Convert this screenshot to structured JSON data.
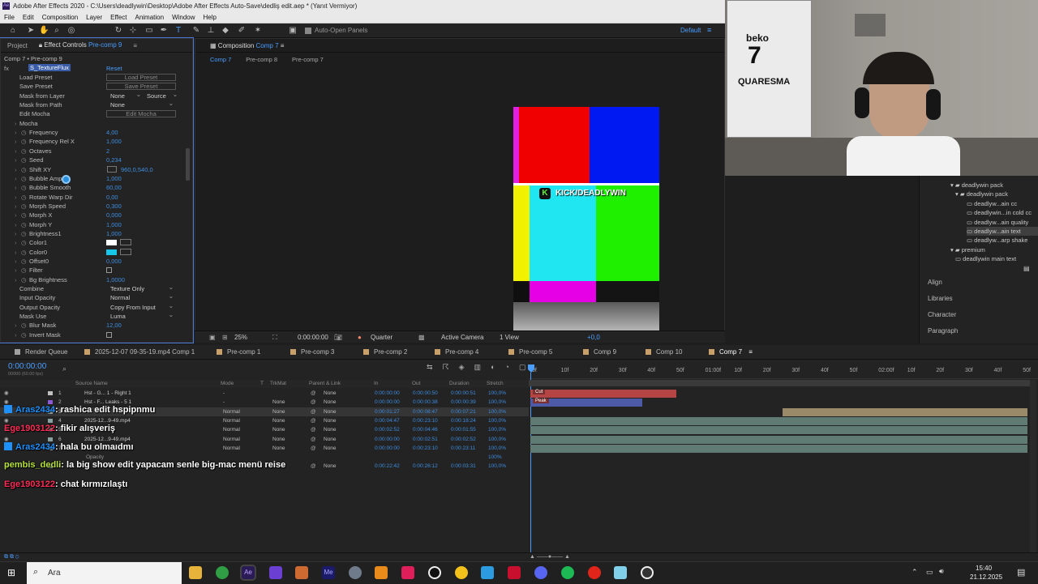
{
  "window": {
    "title": "Adobe After Effects 2020 - C:\\Users\\deadlywin\\Desktop\\Adobe After Effects Auto-Save\\dedliş edit.aep * (Yanıt Vermiyor)"
  },
  "menu": [
    "File",
    "Edit",
    "Composition",
    "Layer",
    "Effect",
    "Animation",
    "Window",
    "Help"
  ],
  "toolbar": {
    "auto_open": "Auto-Open Panels",
    "workspace": "Default"
  },
  "project_panel": {
    "tab_project": "Project",
    "tab_effects": "Effect Controls",
    "tab_effects_target": "Pre-comp 9",
    "breadcrumb": "Comp 7 • Pre-comp 9",
    "effect_name": "S_TextureFlux",
    "reset": "Reset",
    "params": [
      {
        "label": "Load Preset",
        "button": "Load Preset"
      },
      {
        "label": "Save Preset",
        "button": "Save Preset"
      },
      {
        "label": "Mask from Layer",
        "drop1": "None",
        "drop2": "Source"
      },
      {
        "label": "Mask from Path",
        "drop1": "None"
      },
      {
        "label": "Edit Mocha",
        "button": "Edit Mocha"
      },
      {
        "label": "Mocha"
      },
      {
        "label": "Frequency",
        "value": "4,00"
      },
      {
        "label": "Frequency Rel X",
        "value": "1,000"
      },
      {
        "label": "Octaves",
        "value": "2"
      },
      {
        "label": "Seed",
        "value": "0,234"
      },
      {
        "label": "Shift XY",
        "value": "960,0,540,0"
      },
      {
        "label": "Bubble Amp",
        "value": "1,000"
      },
      {
        "label": "Bubble Smooth",
        "value": "60,00"
      },
      {
        "label": "Rotate Warp Dir",
        "value": "0,00"
      },
      {
        "label": "Morph Speed",
        "value": "0,300"
      },
      {
        "label": "Morph X",
        "value": "0,000"
      },
      {
        "label": "Morph Y",
        "value": "1,000"
      },
      {
        "label": "Brightness1",
        "value": "1,000"
      },
      {
        "label": "Color1",
        "swatch": "#ffffff"
      },
      {
        "label": "Color0",
        "swatch": "#17c6e8"
      },
      {
        "label": "Offset0",
        "value": "0,000"
      },
      {
        "label": "Filter",
        "checkbox": true
      },
      {
        "label": "Bg Brightness",
        "value": "1,0000"
      },
      {
        "label": "Combine",
        "drop1": "Texture Only"
      },
      {
        "label": "Input Opacity",
        "drop1": "Normal"
      },
      {
        "label": "Output Opacity",
        "drop1": "Copy From Input"
      },
      {
        "label": "Mask Use",
        "drop1": "Luma"
      },
      {
        "label": "Blur Mask",
        "value": "12,00"
      },
      {
        "label": "Invert Mask",
        "checkbox": true
      }
    ]
  },
  "composition_panel": {
    "tab": "Composition",
    "tab_target": "Comp 7",
    "crumbs": [
      "Comp 7",
      "Pre-comp 8",
      "Pre-comp 7"
    ],
    "overlay_text": "KICK/DEADLYWIN",
    "viewer_bar": {
      "zoom": "25%",
      "time": "0:00:00:00",
      "resolution": "Quarter",
      "camera": "Active Camera",
      "view": "1 View",
      "exposure": "+0,0"
    }
  },
  "right_panel": {
    "tree": [
      "deadlywin pack",
      "deadlywin pack",
      "deadlyw...ain cc",
      "deadlywin...in cold cc",
      "deadlyw...ain quality",
      "deadlyw...ain text",
      "deadlyw...arp shake",
      "premium",
      "deadlywin main text"
    ],
    "sections": [
      "Align",
      "Libraries",
      "Character",
      "Paragraph"
    ]
  },
  "timeline": {
    "tabs": [
      "Render Queue",
      "2025-12-07 09-35-19.mp4 Comp 1",
      "Pre-comp 1",
      "Pre-comp 3",
      "Pre-comp 2",
      "Pre-comp 4",
      "Pre-comp 5",
      "Comp 9",
      "Comp 10",
      "Comp 7"
    ],
    "tab_colors": [
      "#a0a0a0",
      "#c9a06a",
      "#c9a06a",
      "#c9a06a",
      "#c9a06a",
      "#c9a06a",
      "#c9a06a",
      "#c9a06a",
      "#c9a06a",
      "#c9a06a"
    ],
    "timecode": "0:00:00:00",
    "fps": "00000 (60.00 fps)",
    "headers": [
      "Source Name",
      "Mode",
      "T",
      "TrkMat",
      "Parent & Link",
      "In",
      "Out",
      "Duration",
      "Stretch"
    ],
    "ruler": [
      "0f",
      "10f",
      "20f",
      "30f",
      "40f",
      "50f",
      "01:00f",
      "10f",
      "20f",
      "30f",
      "40f",
      "50f",
      "02:00f",
      "10f",
      "20f",
      "30f",
      "40f",
      "50f"
    ],
    "layers": [
      {
        "num": "1",
        "name": "Hst - G... 1 - Right 1",
        "mode": "-",
        "trk": "",
        "parent": "None",
        "in": "0:00:00:00",
        "out": "0:00:00:50",
        "dur": "0:00:00:51",
        "stretch": "100,0%"
      },
      {
        "num": "2",
        "name": "Hst - F... Leaks - 5 1",
        "mode": "-",
        "trk": "None",
        "parent": "None",
        "in": "0:00:00:00",
        "out": "0:00:00:38",
        "dur": "0:00:00:39",
        "stretch": "100,0%"
      },
      {
        "num": "3",
        "name": "",
        "mode": "Normal",
        "trk": "None",
        "parent": "None",
        "in": "0:00:01:27",
        "out": "0:00:08:47",
        "dur": "0:00:07:21",
        "stretch": "100,0%"
      },
      {
        "num": "4",
        "name": "2025-12...9-49.mp4",
        "mode": "Normal",
        "trk": "None",
        "parent": "None",
        "in": "0:00:04:47",
        "out": "0:00:23:10",
        "dur": "0:00:18:24",
        "stretch": "100,0%"
      },
      {
        "num": "5",
        "name": "",
        "mode": "Normal",
        "trk": "None",
        "parent": "None",
        "in": "0:00:02:52",
        "out": "0:00:04:46",
        "dur": "0:00:01:55",
        "stretch": "100,0%"
      },
      {
        "num": "6",
        "name": "2025-12...9-49.mp4",
        "mode": "Normal",
        "trk": "None",
        "parent": "None",
        "in": "0:00:00:00",
        "out": "0:00:02:51",
        "dur": "0:00:02:52",
        "stretch": "100,0%"
      },
      {
        "num": "7",
        "name": "",
        "mode": "Normal",
        "trk": "None",
        "parent": "None",
        "in": "0:00:00:00",
        "out": "0:00:23:10",
        "dur": "0:00:23:11",
        "stretch": "100,0%"
      },
      {
        "num": "",
        "name": "Opacity",
        "mode": "",
        "trk": "",
        "parent": "",
        "in": "",
        "out": "",
        "dur": "",
        "stretch": "100%"
      },
      {
        "num": "8",
        "name": "",
        "mode": "",
        "trk": "",
        "parent": "None",
        "in": "0:00:22:42",
        "out": "0:00:26:12",
        "dur": "0:00:03:31",
        "stretch": "100,0%"
      }
    ],
    "bar_labels": [
      "Cut",
      "Peak"
    ]
  },
  "chat": [
    {
      "user": "Aras2434",
      "message": ": rashica edit hspipnmu",
      "color": "#1e90ff"
    },
    {
      "user": "Ege1903122",
      "message": ": fikir alışveriş",
      "color": "#ff2d55"
    },
    {
      "user": "Aras2434",
      "message": ": hala bu olmaıdmı",
      "color": "#1e90ff"
    },
    {
      "user": "pembis_dedli",
      "message": ": la big show edit yapacam senle big-mac menü reise",
      "color": "#b7e23a"
    },
    {
      "user": "Ege1903122",
      "message": ": chat kırmızılaştı",
      "color": "#ff2d55"
    }
  ],
  "webcam": {
    "shirt_brand": "beko",
    "shirt_name": "QUARESMA",
    "shirt_number": "7"
  },
  "taskbar": {
    "search": "Ara",
    "time": "15:40",
    "date": "21.12.2025"
  }
}
